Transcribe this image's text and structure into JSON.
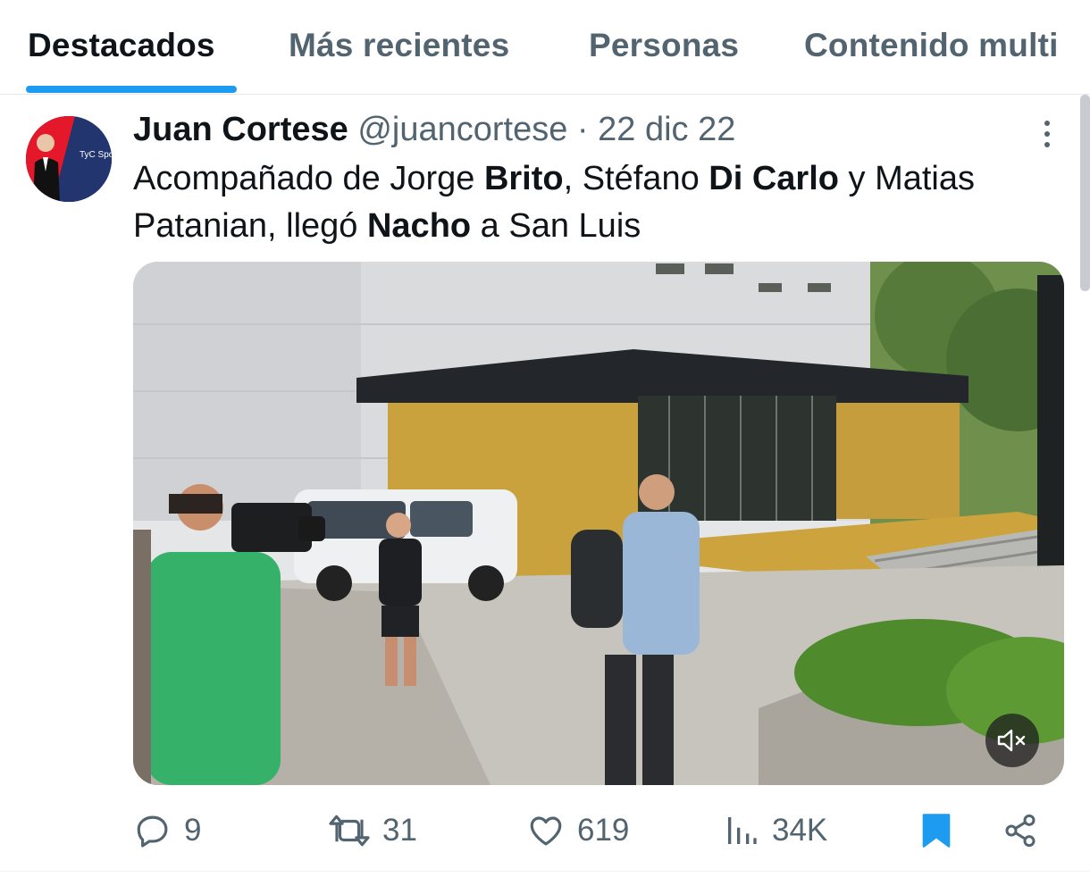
{
  "tabs": [
    {
      "label": "Destacados",
      "active": true
    },
    {
      "label": "Más recientes",
      "active": false
    },
    {
      "label": "Personas",
      "active": false
    },
    {
      "label": "Contenido multi",
      "active": false
    }
  ],
  "tweet": {
    "author_name": "Juan Cortese",
    "author_handle": "@juancortese",
    "separator": "·",
    "date": "22 dic 22",
    "text_parts": {
      "p1": "Acompañado de Jorge ",
      "b1": "Brito",
      "p2": ", Stéfano ",
      "b2": "Di Carlo",
      "p3": " y Matias Patanian, llegó ",
      "b3": "Nacho",
      "p4": " a San Luis"
    },
    "avatar_badge_text": "TyC Sports",
    "media_icon": "mute-icon",
    "more_icon": "more-vertical-icon"
  },
  "actions": {
    "replies": "9",
    "retweets": "31",
    "likes": "619",
    "views": "34K",
    "bookmark_active": true
  },
  "colors": {
    "accent": "#1d9bf0",
    "text_primary": "#0f1419",
    "text_secondary": "#536471"
  }
}
